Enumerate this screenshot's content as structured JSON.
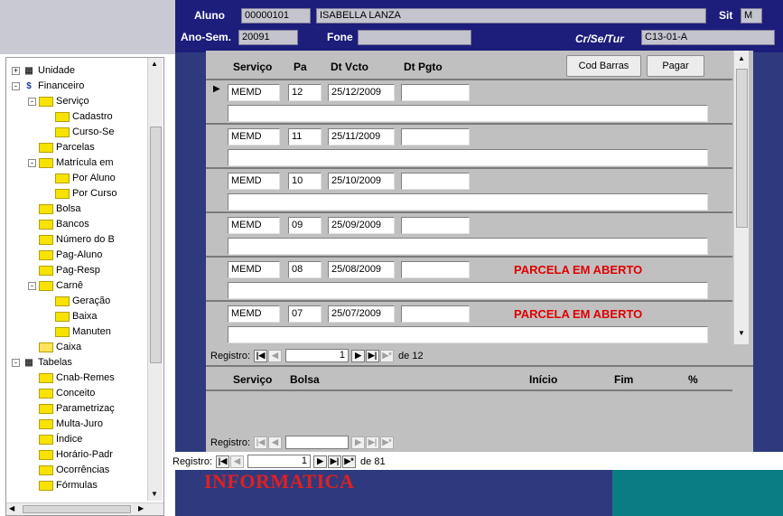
{
  "header": {
    "aluno_label": "Aluno",
    "aluno_id": "00000101",
    "aluno_nome": "ISABELLA LANZA",
    "sit_label": "Sit",
    "sit_value": "M",
    "anosem_label": "Ano-Sem.",
    "anosem_value": "20091",
    "fone_label": "Fone",
    "fone_value": "",
    "crsetur_label": "Cr/Se/Tur",
    "crsetur_value": "C13-01-A"
  },
  "tree": [
    {
      "label": "Unidade",
      "icon": "grid-icon",
      "expand": "+"
    },
    {
      "label": "Financeiro",
      "icon": "money-icon",
      "expand": "-"
    },
    {
      "label": "Serviço",
      "icon": "folder-icon",
      "expand": "-"
    },
    {
      "label": "Cadastro",
      "icon": "folder-icon",
      "expand": ""
    },
    {
      "label": "Curso-Se",
      "icon": "folder-icon",
      "expand": ""
    },
    {
      "label": "Parcelas",
      "icon": "folder-icon",
      "expand": ""
    },
    {
      "label": "Matrícula em",
      "icon": "folder-icon",
      "expand": "-"
    },
    {
      "label": "Por Aluno",
      "icon": "folder-icon",
      "expand": ""
    },
    {
      "label": "Por Curso",
      "icon": "folder-icon",
      "expand": ""
    },
    {
      "label": "Bolsa",
      "icon": "folder-icon",
      "expand": ""
    },
    {
      "label": "Bancos",
      "icon": "folder-icon",
      "expand": ""
    },
    {
      "label": "Número do B",
      "icon": "folder-icon",
      "expand": ""
    },
    {
      "label": "Pag-Aluno",
      "icon": "folder-icon",
      "expand": ""
    },
    {
      "label": "Pag-Resp",
      "icon": "folder-icon",
      "expand": ""
    },
    {
      "label": "Carnê",
      "icon": "folder-icon",
      "expand": "-"
    },
    {
      "label": "Geração",
      "icon": "folder-icon",
      "expand": ""
    },
    {
      "label": "Baixa",
      "icon": "folder-icon",
      "expand": ""
    },
    {
      "label": "Manuten",
      "icon": "folder-icon",
      "expand": ""
    },
    {
      "label": "Caixa",
      "icon": "folder-open-icon",
      "expand": ""
    },
    {
      "label": "Tabelas",
      "icon": "table-icon",
      "expand": "-"
    },
    {
      "label": "Cnab-Remes",
      "icon": "folder-icon",
      "expand": ""
    },
    {
      "label": "Conceito",
      "icon": "folder-icon",
      "expand": ""
    },
    {
      "label": "Parametrizaç",
      "icon": "folder-icon",
      "expand": ""
    },
    {
      "label": "Multa-Juro",
      "icon": "folder-icon",
      "expand": ""
    },
    {
      "label": "Índice",
      "icon": "folder-icon",
      "expand": ""
    },
    {
      "label": "Horário-Padr",
      "icon": "folder-icon",
      "expand": ""
    },
    {
      "label": "Ocorrências",
      "icon": "folder-icon",
      "expand": ""
    },
    {
      "label": "Fórmulas",
      "icon": "folder-icon",
      "expand": ""
    }
  ],
  "parcelas": {
    "columns": {
      "servico": "Serviço",
      "pa": "Pa",
      "dtvcto": "Dt Vcto",
      "dtpgto": "Dt Pgto"
    },
    "buttons": {
      "codbarras": "Cod Barras",
      "pagar": "Pagar"
    },
    "rows": [
      {
        "servico": "MEMD",
        "pa": "12",
        "dtvcto": "25/12/2009",
        "dtpgto": "",
        "status": ""
      },
      {
        "servico": "MEMD",
        "pa": "11",
        "dtvcto": "25/11/2009",
        "dtpgto": "",
        "status": ""
      },
      {
        "servico": "MEMD",
        "pa": "10",
        "dtvcto": "25/10/2009",
        "dtpgto": "",
        "status": ""
      },
      {
        "servico": "MEMD",
        "pa": "09",
        "dtvcto": "25/09/2009",
        "dtpgto": "",
        "status": ""
      },
      {
        "servico": "MEMD",
        "pa": "08",
        "dtvcto": "25/08/2009",
        "dtpgto": "",
        "status": "PARCELA EM ABERTO"
      },
      {
        "servico": "MEMD",
        "pa": "07",
        "dtvcto": "25/07/2009",
        "dtpgto": "",
        "status": "PARCELA EM ABERTO"
      }
    ],
    "nav": {
      "label": "Registro:",
      "current": "1",
      "total": "de 12"
    }
  },
  "bolsa": {
    "columns": {
      "servico": "Serviço",
      "bolsa": "Bolsa",
      "inicio": "Início",
      "fim": "Fim",
      "pct": "%"
    },
    "nav": {
      "label": "Registro:",
      "current": "",
      "total": ""
    }
  },
  "mainnav": {
    "label": "Registro:",
    "current": "1",
    "total": "de 81"
  },
  "watermark": "INFORMATICA"
}
